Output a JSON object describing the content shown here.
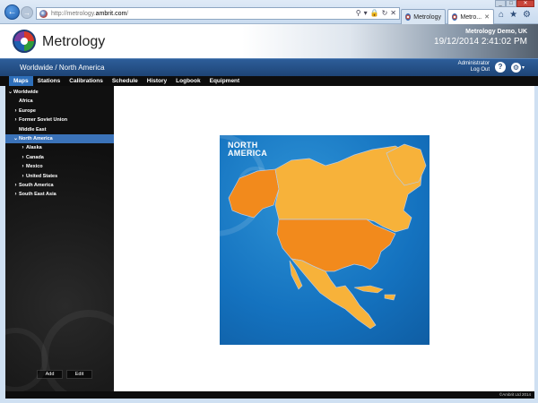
{
  "browser": {
    "url_prefix": "http://metrology.",
    "url_domain": "ambrit.com",
    "url_suffix": "/",
    "tabs": [
      {
        "label": "Metrology"
      },
      {
        "label": "Metro..."
      }
    ]
  },
  "header": {
    "logo_text": "Metrology",
    "demo_name": "Metrology Demo, UK",
    "datetime": "19/12/2014   2:41:02 PM"
  },
  "crumbbar": {
    "breadcrumb": "Worldwide / North America",
    "user": "Administrator",
    "logout": "Log Out",
    "help": "?"
  },
  "nav": {
    "items": [
      {
        "label": "Maps"
      },
      {
        "label": "Stations"
      },
      {
        "label": "Calibrations"
      },
      {
        "label": "Schedule"
      },
      {
        "label": "History"
      },
      {
        "label": "Logbook"
      },
      {
        "label": "Equipment"
      }
    ]
  },
  "tree": {
    "items": [
      {
        "label": "Worldwide",
        "indent": 0,
        "arrow": "v"
      },
      {
        "label": "Africa",
        "indent": 1,
        "arrow": ""
      },
      {
        "label": "Europe",
        "indent": 1,
        "arrow": ">"
      },
      {
        "label": "Former Soviet Union",
        "indent": 1,
        "arrow": ">"
      },
      {
        "label": "Middle East",
        "indent": 1,
        "arrow": ""
      },
      {
        "label": "North America",
        "indent": 1,
        "arrow": "v"
      },
      {
        "label": "Alaska",
        "indent": 2,
        "arrow": ">"
      },
      {
        "label": "Canada",
        "indent": 2,
        "arrow": ">"
      },
      {
        "label": "Mexico",
        "indent": 2,
        "arrow": ">"
      },
      {
        "label": "United States",
        "indent": 2,
        "arrow": ">"
      },
      {
        "label": "South America",
        "indent": 1,
        "arrow": ">"
      },
      {
        "label": "South East Asia",
        "indent": 1,
        "arrow": ">"
      }
    ],
    "add_label": "Add",
    "edit_label": "Edit"
  },
  "map": {
    "title_line1": "NORTH",
    "title_line2": "AMERICA",
    "colors": {
      "ocean": "#1472bf",
      "highlight": "#f28a1c",
      "land": "#f7b23a"
    }
  },
  "footer": {
    "copyright": "©Ambrit Ltd 2014"
  }
}
